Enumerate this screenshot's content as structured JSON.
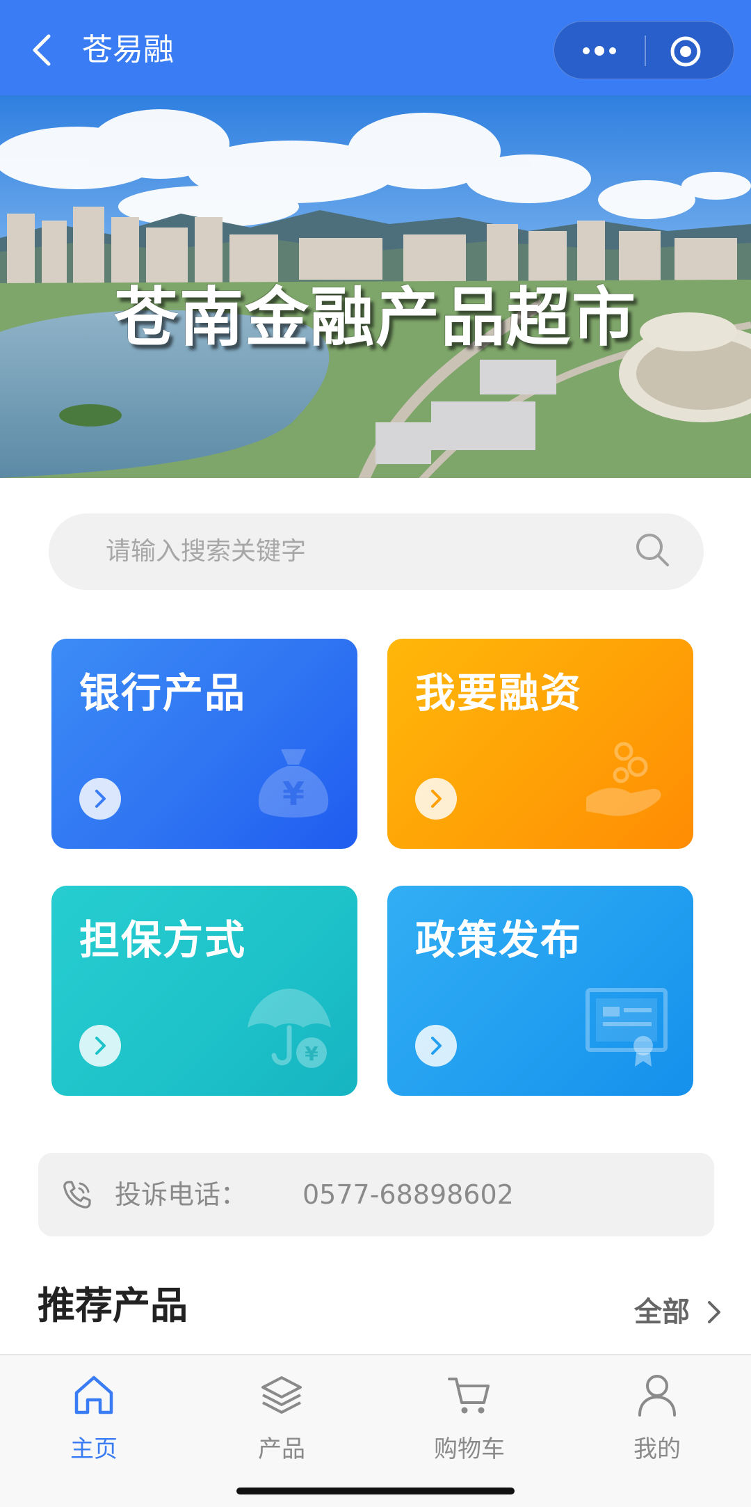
{
  "header": {
    "title": "苍易融",
    "back_icon": "chevron-left-icon",
    "more_icon": "more-dots-icon",
    "close_icon": "target-circle-icon",
    "background": "#3a7cf4"
  },
  "banner": {
    "title": "苍南金融产品超市"
  },
  "search": {
    "placeholder": "请输入搜索关键字",
    "icon": "search-icon"
  },
  "cards": [
    {
      "title": "银行产品",
      "icon": "money-bag-icon",
      "color": "#2f74f2"
    },
    {
      "title": "我要融资",
      "icon": "hand-coins-icon",
      "color": "#ffa106"
    },
    {
      "title": "担保方式",
      "icon": "umbrella-yuan-icon",
      "color": "#1ec3c9"
    },
    {
      "title": "政策发布",
      "icon": "certificate-icon",
      "color": "#229ff0"
    }
  ],
  "complaint": {
    "label": "投诉电话：",
    "number": "0577-68898602",
    "icon": "phone-icon"
  },
  "recommended": {
    "title": "推荐产品",
    "all_label": "全部"
  },
  "tabbar": {
    "items": [
      {
        "label": "主页",
        "icon": "home-icon",
        "active": true
      },
      {
        "label": "产品",
        "icon": "layers-icon",
        "active": false
      },
      {
        "label": "购物车",
        "icon": "cart-icon",
        "active": false
      },
      {
        "label": "我的",
        "icon": "user-icon",
        "active": false
      }
    ],
    "active_color": "#3a7cf4"
  }
}
